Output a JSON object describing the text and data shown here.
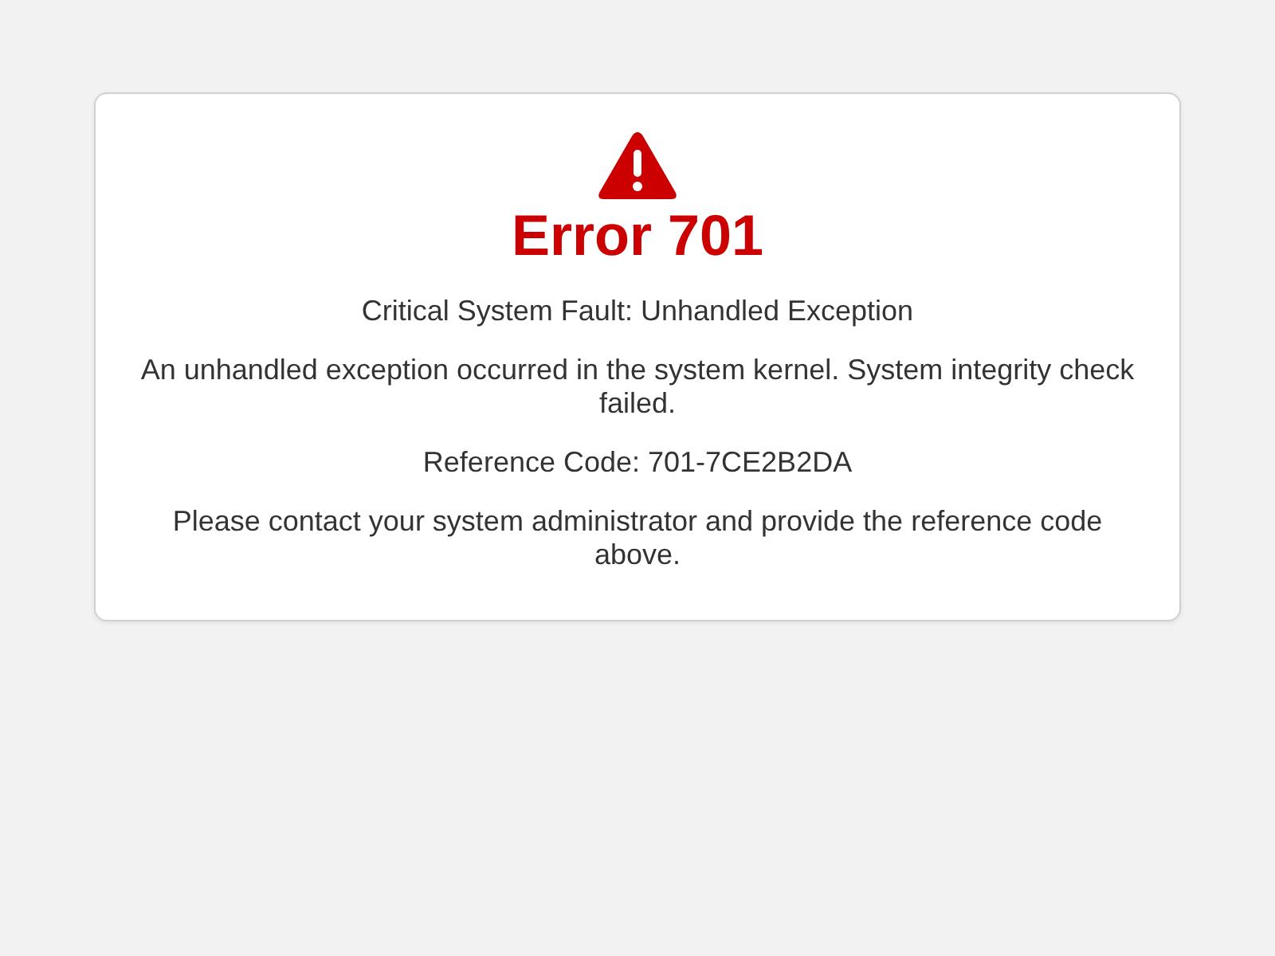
{
  "error": {
    "title": "Error 701",
    "summary": "Critical System Fault: Unhandled Exception",
    "description": "An unhandled exception occurred in the system kernel. System integrity check failed.",
    "reference": "Reference Code: 701-7CE2B2DA",
    "instruction": "Please contact your system administrator and provide the reference code above."
  }
}
